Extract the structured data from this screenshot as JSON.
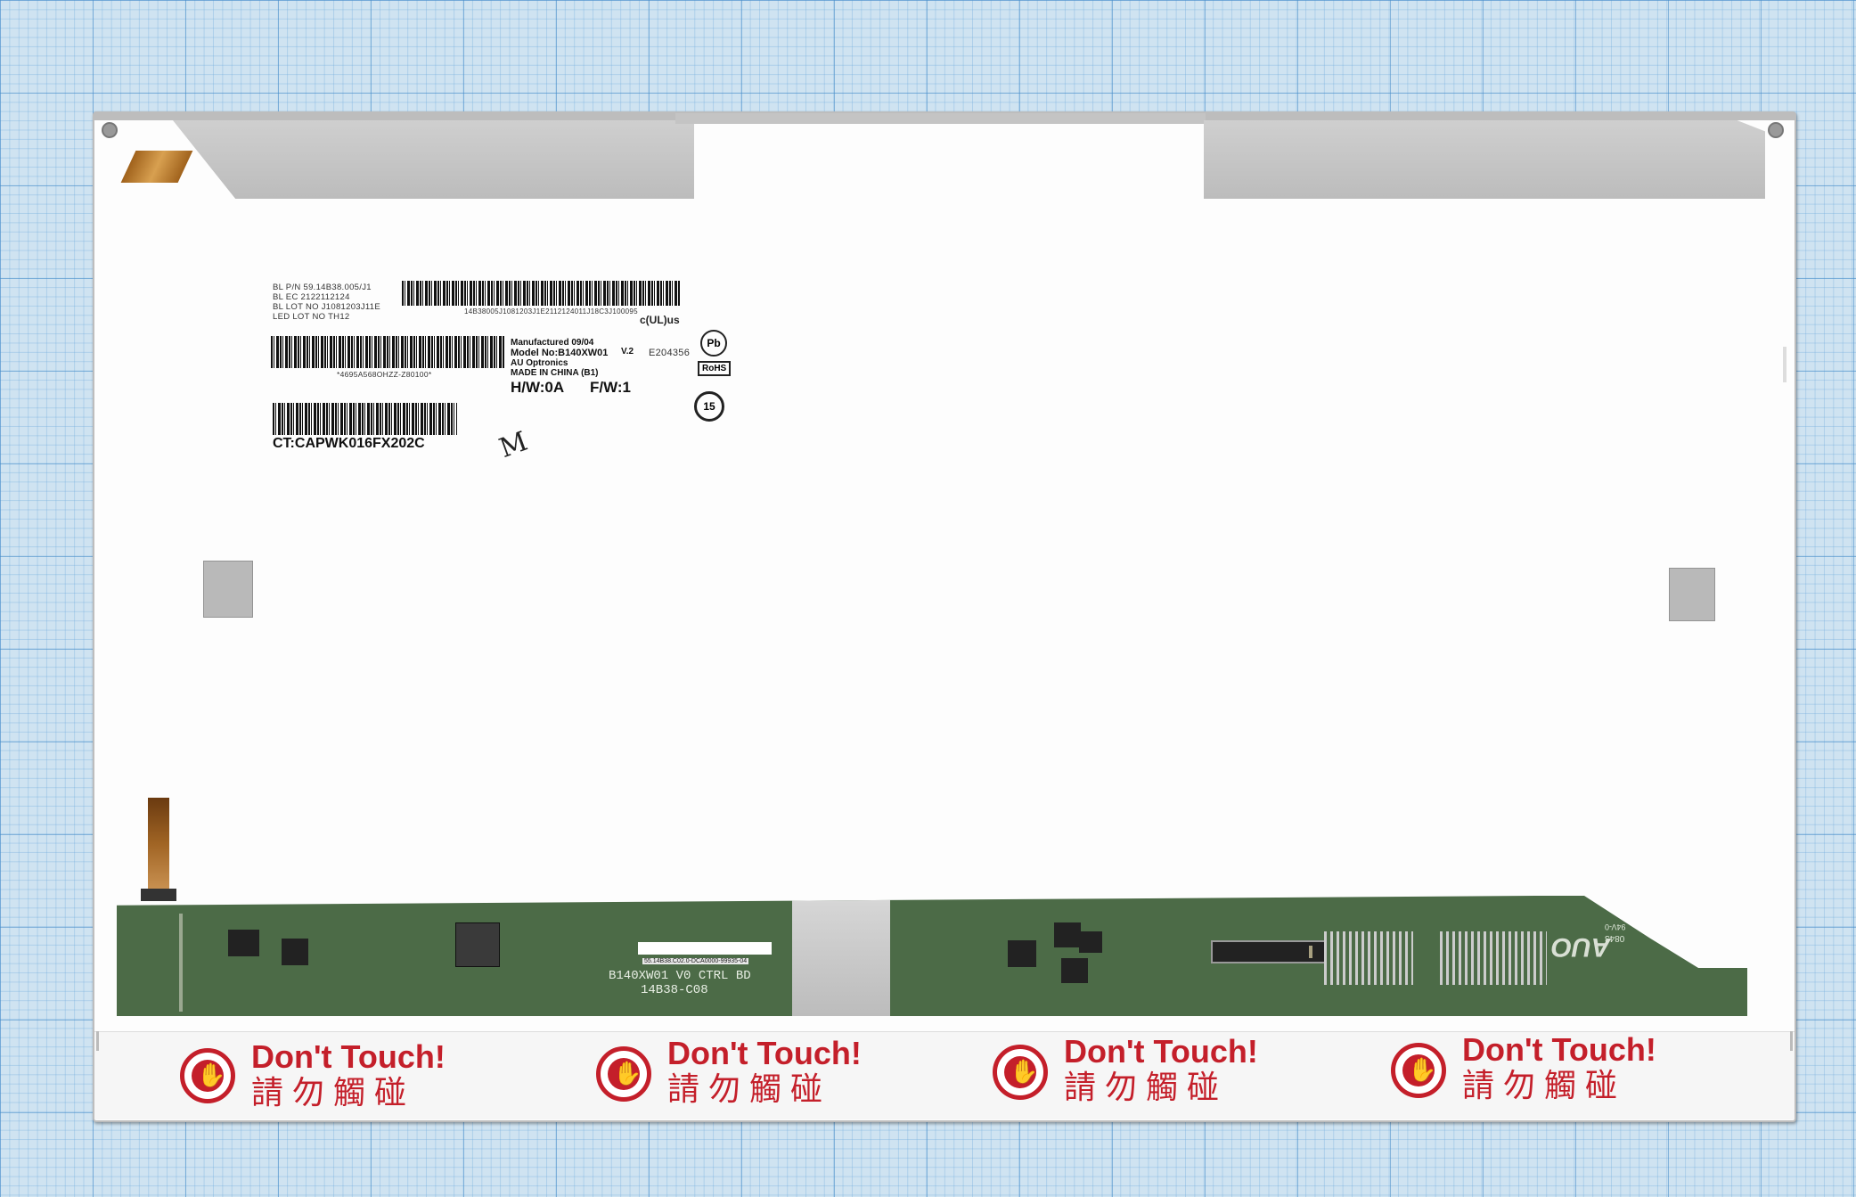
{
  "label_block": {
    "bl_pn": "BL P/N 59.14B38.005/J1",
    "bl_ec": "BL EC  2122112124",
    "bl_lot": "BL LOT NO J1081203J11E",
    "led_lot": "LED LOT NO TH12",
    "barcode1_caption": "14B38005J1081203J1E2112124011J18C3J100095",
    "barcode2_caption": "*4695A568OHZZ-Z80100*",
    "ct_code": "CT:CAPWK016FX202C",
    "handwritten_mark": "M"
  },
  "model_block": {
    "manufactured": "Manufactured 09/04",
    "model_no": "Model No:B140XW01",
    "version": "V.2",
    "maker": "AU Optronics",
    "made_in": "MADE IN CHINA (B1)",
    "hw": "H/W:0A",
    "fw": "F/W:1"
  },
  "certifications": {
    "ul_mark": "c(UL)us",
    "ul_file": "E204356",
    "pb_free": "Pb",
    "rohs": "RoHS",
    "recycle_years": "15"
  },
  "pcb": {
    "board_name": "B140XW01 V0 CTRL BD",
    "board_code": "14B38-C08",
    "sticker_text": "55.14B38.C02.0-DCA0000-99935-04",
    "logo": "AUO",
    "date_code": "0843",
    "rating": "94V-0"
  },
  "warnings": [
    {
      "title": "Don't Touch!",
      "cjk": "請勿觸碰"
    },
    {
      "title": "Don't Touch!",
      "cjk": "請勿觸碰"
    },
    {
      "title": "Don't Touch!",
      "cjk": "請勿觸碰"
    },
    {
      "title": "Don't Touch!",
      "cjk": "請勿觸碰"
    }
  ],
  "colors": {
    "grid_paper": "#cfe3f1",
    "panel": "#fdfdfd",
    "pcb_green": "#4c6b47",
    "warning_red": "#c41f2a"
  }
}
